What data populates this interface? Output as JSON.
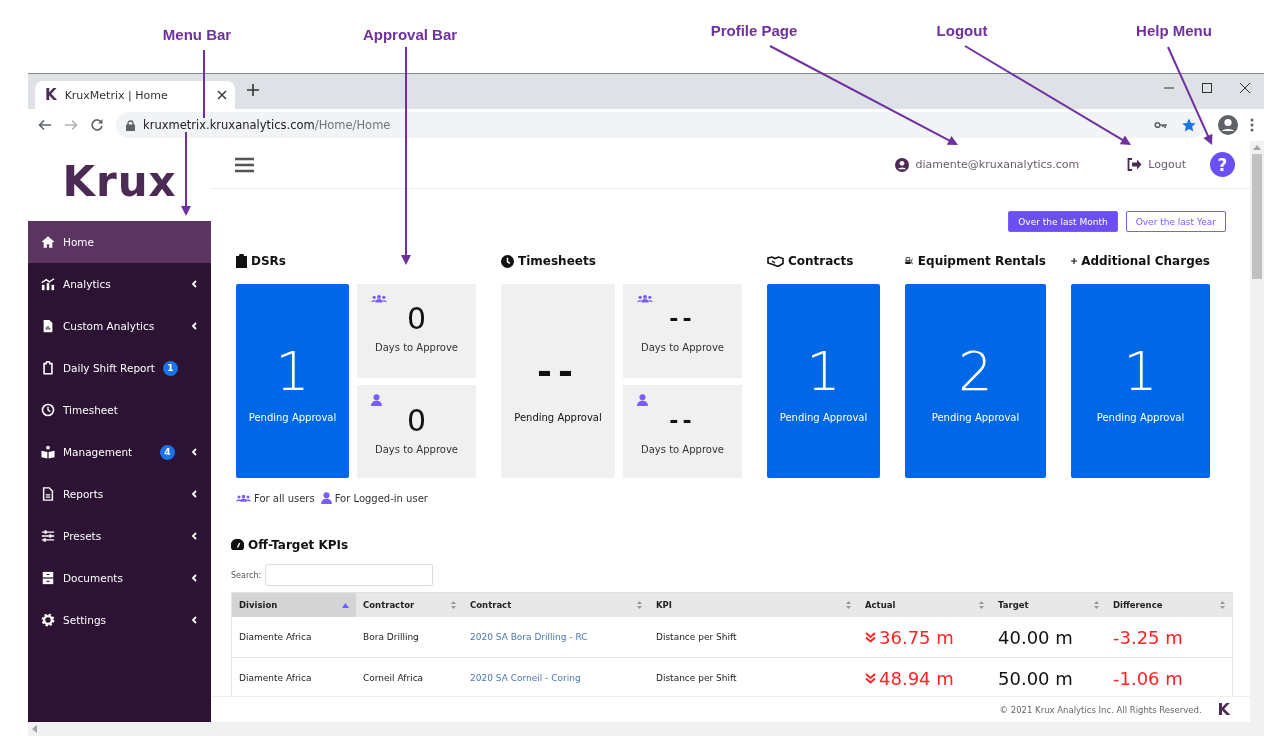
{
  "annotations": [
    {
      "label": "Menu Bar"
    },
    {
      "label": "Approval Bar"
    },
    {
      "label": "Profile Page"
    },
    {
      "label": "Logout"
    },
    {
      "label": "Help Menu"
    }
  ],
  "browser": {
    "favicon": "K",
    "tab_title": "KruxMetrix | Home",
    "url_host": "kruxmetrix.kruxanalytics.com",
    "url_path": "/Home/Home"
  },
  "sidebar": {
    "logo": "Krux",
    "items": [
      {
        "label": "Home",
        "selected": true,
        "submenu": false
      },
      {
        "label": "Analytics",
        "selected": false,
        "submenu": true
      },
      {
        "label": "Custom Analytics",
        "selected": false,
        "submenu": true
      },
      {
        "label": "Daily Shift Report",
        "selected": false,
        "submenu": false,
        "badge": "1"
      },
      {
        "label": "Timesheet",
        "selected": false,
        "submenu": false
      },
      {
        "label": "Management",
        "selected": false,
        "submenu": true,
        "badge": "4"
      },
      {
        "label": "Reports",
        "selected": false,
        "submenu": true
      },
      {
        "label": "Presets",
        "selected": false,
        "submenu": true
      },
      {
        "label": "Documents",
        "selected": false,
        "submenu": true
      },
      {
        "label": "Settings",
        "selected": false,
        "submenu": true
      }
    ]
  },
  "header": {
    "user_email": "diamente@kruxanalytics.com",
    "logout": "Logout",
    "help": "?"
  },
  "period_buttons": [
    {
      "label": "Over the last Month",
      "selected": true
    },
    {
      "label": "Over the last Year",
      "selected": false
    }
  ],
  "approval_sections": [
    {
      "title": "DSRs",
      "main": {
        "value": "1",
        "label": "Pending Approval",
        "highlighted": true
      },
      "details": [
        {
          "value": "0",
          "label": "Days to Approve"
        },
        {
          "value": "0",
          "label": "Days to Approve"
        }
      ]
    },
    {
      "title": "Timesheets",
      "main": {
        "value": "--",
        "label": "Pending Approval",
        "highlighted": false
      },
      "details": [
        {
          "value": "--",
          "label": "Days to Approve"
        },
        {
          "value": "--",
          "label": "Days to Approve"
        }
      ]
    },
    {
      "title": "Contracts",
      "main": {
        "value": "1",
        "label": "Pending Approval",
        "highlighted": true
      }
    },
    {
      "title": "Equipment Rentals",
      "main": {
        "value": "2",
        "label": "Pending Approval",
        "highlighted": true
      }
    },
    {
      "title": "Additional Charges",
      "main": {
        "value": "1",
        "label": "Pending Approval",
        "highlighted": true
      }
    }
  ],
  "legend": [
    {
      "label": "For all users"
    },
    {
      "label": "For Logged-in user"
    }
  ],
  "kpi_table": {
    "title": "Off-Target KPIs",
    "search_label": "Search:",
    "columns": [
      {
        "label": "Division",
        "sorted": true
      },
      {
        "label": "Contractor",
        "sorted": false
      },
      {
        "label": "Contract",
        "sorted": false
      },
      {
        "label": "KPI",
        "sorted": false
      },
      {
        "label": "Actual",
        "sorted": false
      },
      {
        "label": "Target",
        "sorted": false
      },
      {
        "label": "Difference",
        "sorted": false
      }
    ],
    "rows": [
      {
        "division": "Diamente Africa",
        "contractor": "Bora Drilling",
        "contract": "2020 SA Bora Drilling - RC",
        "kpi": "Distance per Shift",
        "actual": "36.75 m",
        "target": "40.00 m",
        "difference": "-3.25 m",
        "below_target": true
      },
      {
        "division": "Diamente Africa",
        "contractor": "Corneil Africa",
        "contract": "2020 SA Corneil - Coring",
        "kpi": "Distance per Shift",
        "actual": "48.94 m",
        "target": "50.00 m",
        "difference": "-1.06 m",
        "below_target": true
      }
    ]
  },
  "footer": {
    "copyright": "© 2021 Krux Analytics Inc. All Rights Reserved.",
    "logo": "K"
  }
}
